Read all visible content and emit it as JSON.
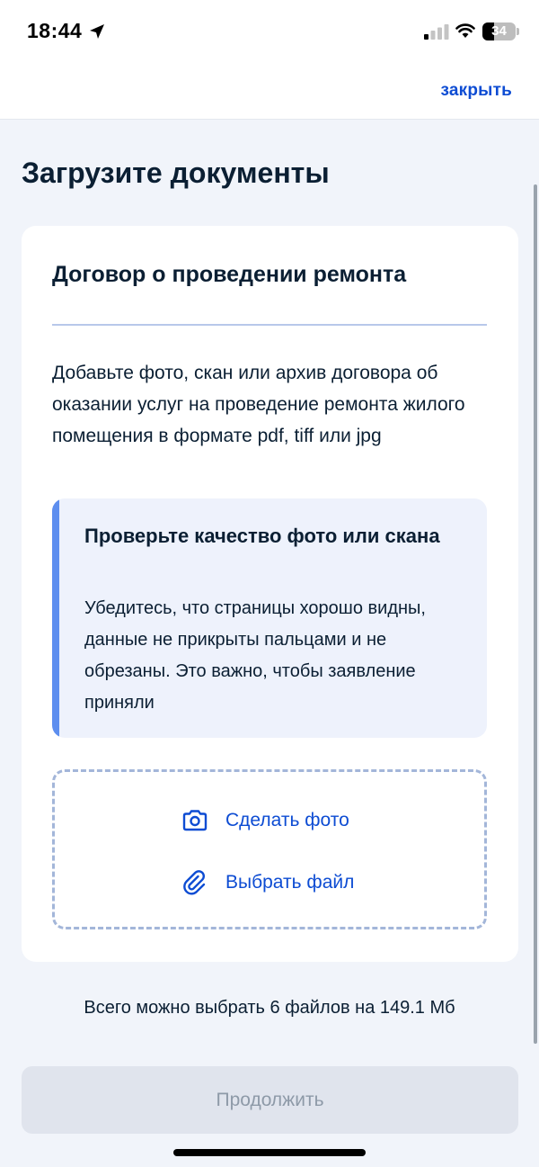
{
  "status_bar": {
    "time": "18:44",
    "battery": "34",
    "battery_level": 0.34
  },
  "header": {
    "close_label": "закрыть"
  },
  "page": {
    "title": "Загрузите документы"
  },
  "card": {
    "title": "Договор о проведении ремонта",
    "description": "Добавьте фото, скан или архив договора об оказании услуг на проведение ремонта жилого помещения в формате pdf, tiff или jpg",
    "hint": {
      "title": "Проверьте качество фото или скана",
      "text": "Убедитесь, что страницы хорошо видны, данные не прикрыты пальцами и не обрезаны. Это важно, чтобы заявление приняли"
    },
    "upload": {
      "take_photo_label": "Сделать фото",
      "take_photo_icon": "camera-icon",
      "choose_file_label": "Выбрать файл",
      "choose_file_icon": "paperclip-icon"
    }
  },
  "limit_note": "Всего можно выбрать 6 файлов на 149.1 Мб",
  "footer": {
    "continue_label": "Продолжить"
  },
  "colors": {
    "accent": "#0d4cd3",
    "hint_accent": "#5d8eef",
    "background": "#f1f4fa",
    "disabled_button": "#e0e4ed"
  }
}
